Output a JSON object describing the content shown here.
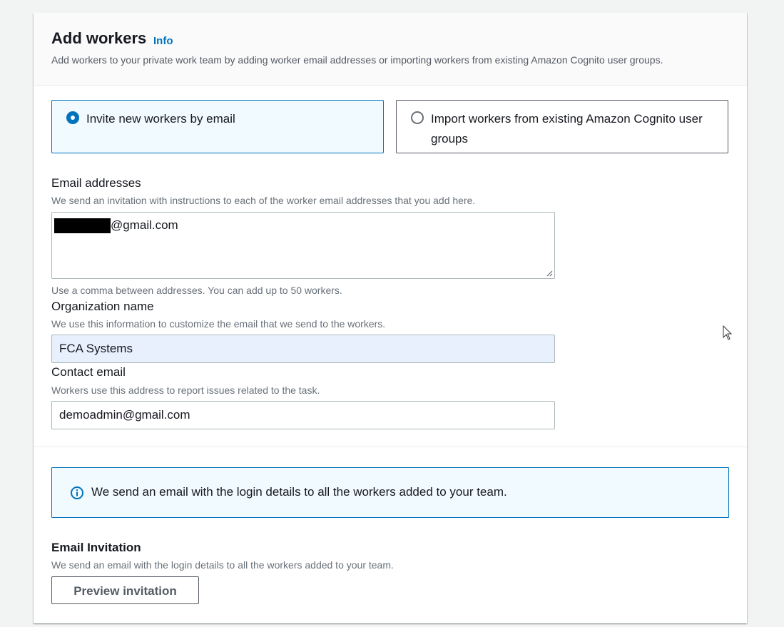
{
  "header": {
    "title": "Add workers",
    "info_link": "Info",
    "description": "Add workers to your private work team by adding worker email addresses or importing workers from existing Amazon Cognito user groups."
  },
  "options": [
    {
      "label": "Invite new workers by email",
      "selected": true
    },
    {
      "label": "Import workers from existing Amazon Cognito user groups",
      "selected": false
    }
  ],
  "email_addresses": {
    "label": "Email addresses",
    "description": "We send an invitation with instructions to each of the worker email addresses that you add here.",
    "value_visible": "@gmail.com",
    "hint": "Use a comma between addresses. You can add up to 50 workers."
  },
  "organization": {
    "label": "Organization name",
    "description": "We use this information to customize the email that we send to the workers.",
    "value": "FCA Systems"
  },
  "contact_email": {
    "label": "Contact email",
    "description": "Workers use this address to report issues related to the task.",
    "value": "demoadmin@gmail.com"
  },
  "alert": {
    "icon": "info-icon",
    "text": "We send an email with the login details to all the workers added to your team."
  },
  "invitation": {
    "title": "Email Invitation",
    "description": "We send an email with the login details to all the workers added to your team.",
    "button": "Preview invitation"
  },
  "colors": {
    "accent": "#0073bb",
    "page_background": "#f2f3f3",
    "selected_tile_background": "#f1faff",
    "autofill_background": "#e8f0fe"
  }
}
